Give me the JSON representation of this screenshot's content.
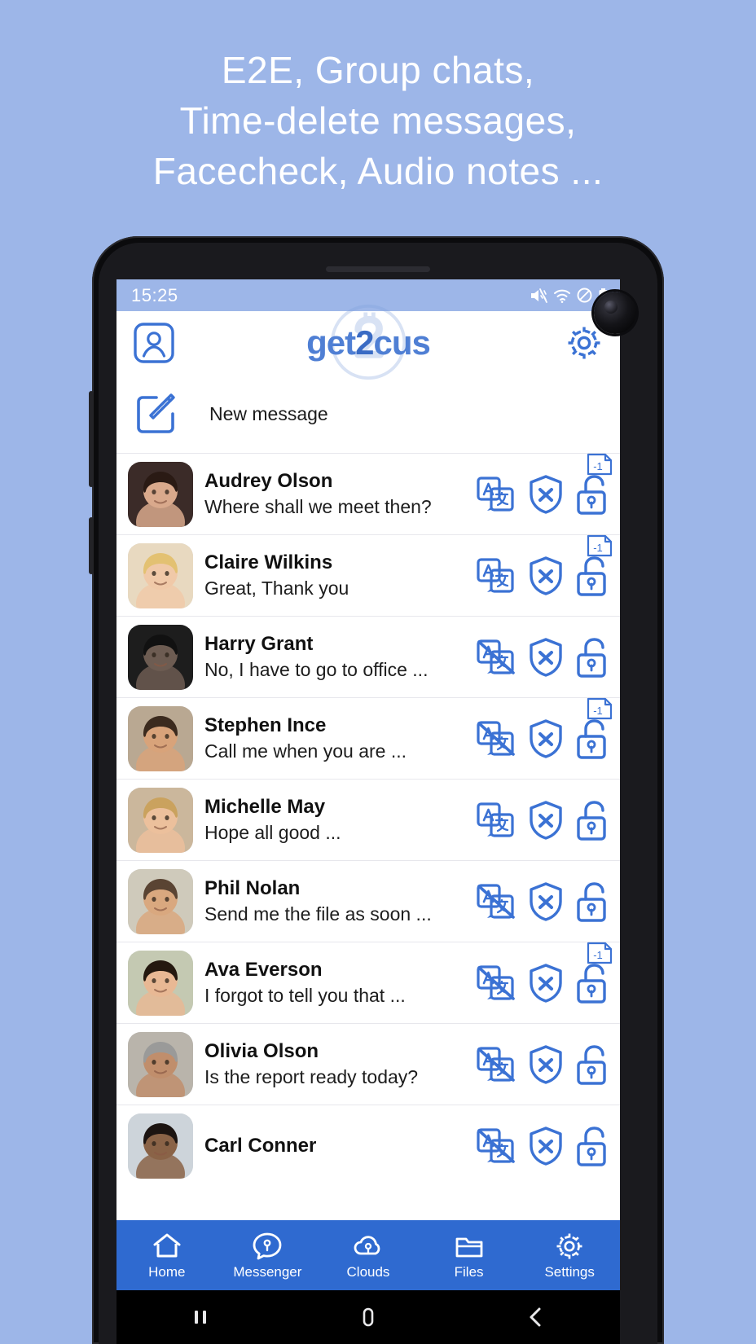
{
  "headline": {
    "line1": "E2E, Group chats,",
    "line2": "Time-delete messages,",
    "line3": "Facecheck, Audio notes ..."
  },
  "statusbar": {
    "time": "15:25",
    "icons": [
      "mute-icon",
      "wifi-icon",
      "do-not-disturb-icon",
      "battery-icon"
    ]
  },
  "app_header": {
    "profile_icon": "profile-icon",
    "logo_part1": "get",
    "logo_two": "2",
    "logo_part2": "cus",
    "settings_icon": "gear-icon"
  },
  "new_message": {
    "icon": "compose-icon",
    "label": "New message"
  },
  "colors": {
    "background": "#9db6e8",
    "accent": "#2f6ad0",
    "icon_blue": "#3b72d4",
    "logo_blue": "#4f7fd4",
    "nav_bar": "#2f6ad0",
    "statusbar": "#9db6e8"
  },
  "chats": [
    {
      "name": "Audrey Olson",
      "preview": "Where shall we meet then?",
      "translate_enabled": true,
      "shield": "shield-x-icon",
      "lock": "open-lock-icon",
      "badge": "-1",
      "avatar_tone": "#3b2b28",
      "skin": "#d9a98c",
      "hair": "#2a1a14"
    },
    {
      "name": "Claire Wilkins",
      "preview": "Great, Thank you",
      "translate_enabled": true,
      "shield": "shield-x-icon",
      "lock": "open-lock-icon",
      "badge": "-1",
      "avatar_tone": "#e8d9c0",
      "skin": "#f0c9a8",
      "hair": "#e3c172"
    },
    {
      "name": "Harry Grant",
      "preview": "No, I have to go to office ...",
      "translate_enabled": false,
      "shield": "shield-x-icon",
      "lock": "open-lock-icon",
      "badge": null,
      "avatar_tone": "#1d1d1d",
      "skin": "#6d5c52",
      "hair": "#111111"
    },
    {
      "name": "Stephen Ince",
      "preview": "Call me when you are ...",
      "translate_enabled": false,
      "shield": "shield-x-icon",
      "lock": "open-lock-icon",
      "badge": "-1",
      "avatar_tone": "#b9a892",
      "skin": "#d8a37a",
      "hair": "#3b2a1e"
    },
    {
      "name": "Michelle May",
      "preview": "Hope all good ...",
      "translate_enabled": true,
      "shield": "shield-x-icon",
      "lock": "open-lock-icon",
      "badge": null,
      "avatar_tone": "#cbb79c",
      "skin": "#ecc09c",
      "hair": "#caa25e"
    },
    {
      "name": "Phil Nolan",
      "preview": "Send me the file as soon ...",
      "translate_enabled": false,
      "shield": "shield-x-icon",
      "lock": "open-lock-icon",
      "badge": null,
      "avatar_tone": "#cfcabb",
      "skin": "#d9a87f",
      "hair": "#5a4433"
    },
    {
      "name": "Ava Everson",
      "preview": "I forgot to tell you that ...",
      "translate_enabled": false,
      "shield": "shield-x-icon",
      "lock": "open-lock-icon",
      "badge": "-1",
      "avatar_tone": "#c4c9b2",
      "skin": "#e8b894",
      "hair": "#24180f"
    },
    {
      "name": "Olivia Olson",
      "preview": "Is the report ready today?",
      "translate_enabled": false,
      "shield": "shield-x-icon",
      "lock": "open-lock-icon",
      "badge": null,
      "avatar_tone": "#b9b4ab",
      "skin": "#c08e6c",
      "hair": "#9a9a99"
    },
    {
      "name": "Carl Conner",
      "preview": "",
      "translate_enabled": false,
      "shield": "shield-x-icon",
      "lock": "open-lock-icon",
      "badge": null,
      "avatar_tone": "#cdd4da",
      "skin": "#8a6347",
      "hair": "#1c1411"
    }
  ],
  "bottom_nav": [
    {
      "label": "Home",
      "icon": "home-icon"
    },
    {
      "label": "Messenger",
      "icon": "messenger-icon"
    },
    {
      "label": "Clouds",
      "icon": "cloud-icon"
    },
    {
      "label": "Files",
      "icon": "folder-icon"
    },
    {
      "label": "Settings",
      "icon": "gear-icon"
    }
  ],
  "system_nav": {
    "recents": "recents-icon",
    "home": "home-pill-icon",
    "back": "back-icon"
  }
}
